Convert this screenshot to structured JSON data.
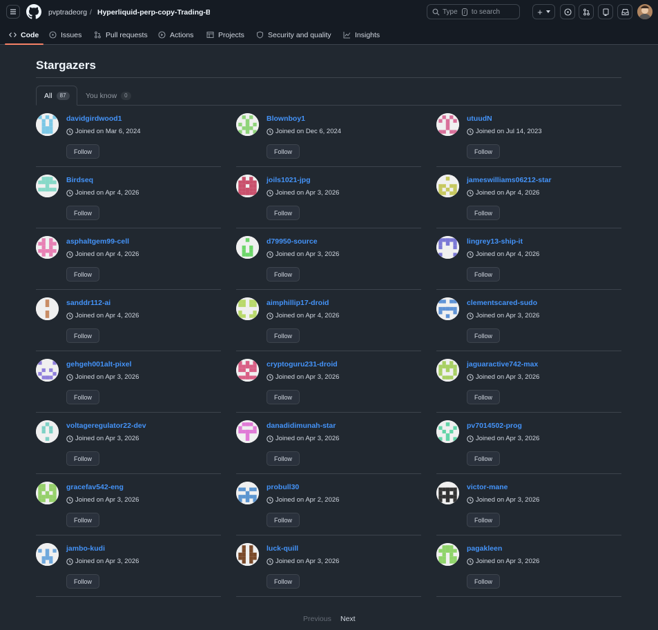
{
  "header": {
    "owner": "pvptradeorg",
    "separator": "/",
    "repo": "Hyperliquid-perp-copy-Trading-Bot",
    "search_prefix": "Type",
    "search_key": "/",
    "search_suffix": "to search",
    "new_label": "+"
  },
  "tabs": [
    {
      "label": "Code",
      "icon": "code-icon"
    },
    {
      "label": "Issues",
      "icon": "issue-icon"
    },
    {
      "label": "Pull requests",
      "icon": "pull-request-icon"
    },
    {
      "label": "Actions",
      "icon": "play-icon"
    },
    {
      "label": "Projects",
      "icon": "table-icon"
    },
    {
      "label": "Security and quality",
      "icon": "shield-icon"
    },
    {
      "label": "Insights",
      "icon": "graph-icon"
    }
  ],
  "page": {
    "title": "Stargazers",
    "subtabs": [
      {
        "label": "All",
        "count": "87"
      },
      {
        "label": "You know",
        "count": "0"
      }
    ],
    "follow_label": "Follow",
    "pager": {
      "previous": "Previous",
      "next": "Next"
    }
  },
  "users": [
    {
      "name": "davidgirdwood1",
      "joined": "Joined on Mar 6, 2024",
      "color": "#7cc8e6"
    },
    {
      "name": "Blownboy1",
      "joined": "Joined on Dec 6, 2024",
      "color": "#8fd47a"
    },
    {
      "name": "utuudN",
      "joined": "Joined on Jul 14, 2023",
      "color": "#d9709a"
    },
    {
      "name": "Birdseq",
      "joined": "Joined on Apr 4, 2026",
      "color": "#86d9c8"
    },
    {
      "name": "joils1021-jpg",
      "joined": "Joined on Apr 3, 2026",
      "color": "#c9506c"
    },
    {
      "name": "jameswilliams06212-star",
      "joined": "Joined on Apr 4, 2026",
      "color": "#c6c85e"
    },
    {
      "name": "asphaltgem99-cell",
      "joined": "Joined on Apr 4, 2026",
      "color": "#e77fb3"
    },
    {
      "name": "d79950-source",
      "joined": "Joined on Apr 3, 2026",
      "color": "#6dd66a"
    },
    {
      "name": "lingrey13-ship-it",
      "joined": "Joined on Apr 4, 2026",
      "color": "#7b78d6"
    },
    {
      "name": "sanddr112-ai",
      "joined": "Joined on Apr 4, 2026",
      "color": "#c98d66"
    },
    {
      "name": "aimphillip17-droid",
      "joined": "Joined on Apr 4, 2026",
      "color": "#b8d96a"
    },
    {
      "name": "clementscared-sudo",
      "joined": "Joined on Apr 3, 2026",
      "color": "#5f93d6"
    },
    {
      "name": "gehgeh001alt-pixel",
      "joined": "Joined on Apr 3, 2026",
      "color": "#8f7fdc"
    },
    {
      "name": "cryptoguru231-droid",
      "joined": "Joined on Apr 3, 2026",
      "color": "#d95f85"
    },
    {
      "name": "jaguaractive742-max",
      "joined": "Joined on Apr 3, 2026",
      "color": "#a8d063"
    },
    {
      "name": "voltageregulator22-dev",
      "joined": "Joined on Apr 3, 2026",
      "color": "#7fd1c6"
    },
    {
      "name": "danadidimunah-star",
      "joined": "Joined on Apr 3, 2026",
      "color": "#e07ad6"
    },
    {
      "name": "pv7014502-prog",
      "joined": "Joined on Apr 3, 2026",
      "color": "#63d4a8"
    },
    {
      "name": "gracefav542-eng",
      "joined": "Joined on Apr 3, 2026",
      "color": "#95d06a"
    },
    {
      "name": "probull30",
      "joined": "Joined on Apr 2, 2026",
      "color": "#5b95d0"
    },
    {
      "name": "victor-mane",
      "joined": "Joined on Apr 3, 2026",
      "color": "#333333"
    },
    {
      "name": "jambo-kudi",
      "joined": "Joined on Apr 3, 2026",
      "color": "#6fa8dc"
    },
    {
      "name": "luck-quill",
      "joined": "Joined on Apr 3, 2026",
      "color": "#7a4a2a"
    },
    {
      "name": "pagakleen",
      "joined": "Joined on Apr 3, 2026",
      "color": "#8fd46a"
    }
  ]
}
